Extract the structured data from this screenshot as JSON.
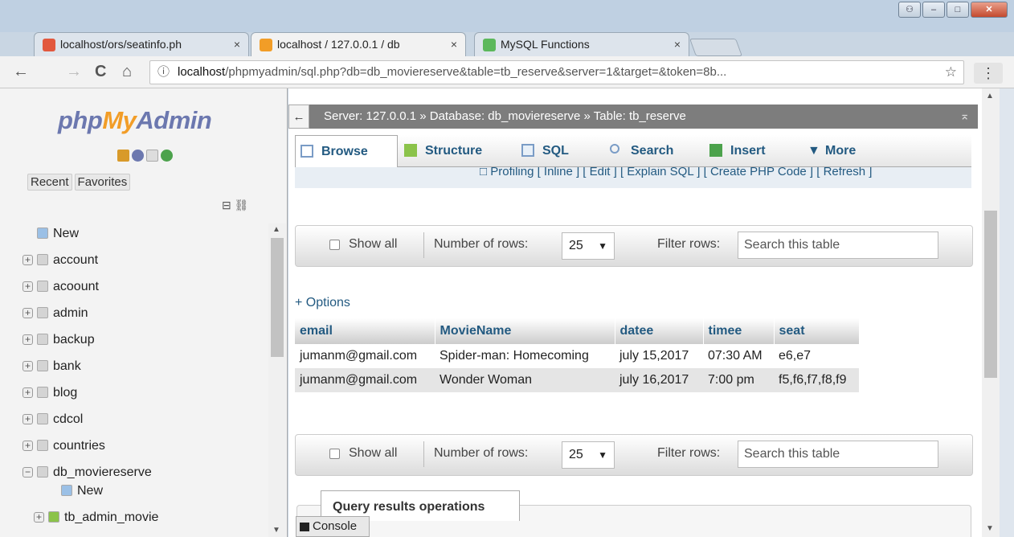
{
  "browser": {
    "tabs": [
      {
        "label": "localhost/ors/seatinfo.ph",
        "close": "×",
        "icon_color": "#e2583e"
      },
      {
        "label": "localhost / 127.0.0.1 / db",
        "close": "×",
        "icon_color": "#f29d27"
      },
      {
        "label": "MySQL Functions",
        "close": "×",
        "icon_color": "#5cb85c"
      }
    ],
    "url_host": "localhost",
    "url_rest": "/phpmyadmin/sql.php?db=db_moviereserve&table=tb_reserve&server=1&target=&token=8b...",
    "back": "←",
    "forward": "→",
    "reload": "C",
    "home": "⌂",
    "info": "ⓘ",
    "star": "☆",
    "menu": "⋮"
  },
  "sidebar": {
    "logo_php": "php",
    "logo_my": "My",
    "logo_admin": "Admin",
    "recent": "Recent",
    "favorites": "Favorites",
    "tree": [
      {
        "label": "New",
        "type": "new"
      },
      {
        "label": "account",
        "type": "db"
      },
      {
        "label": "acoount",
        "type": "db"
      },
      {
        "label": "admin",
        "type": "db"
      },
      {
        "label": "backup",
        "type": "db"
      },
      {
        "label": "bank",
        "type": "db"
      },
      {
        "label": "blog",
        "type": "db"
      },
      {
        "label": "cdcol",
        "type": "db"
      },
      {
        "label": "countries",
        "type": "db"
      },
      {
        "label": "db_moviereserve",
        "type": "db-open"
      },
      {
        "label": "New",
        "type": "sub-new"
      },
      {
        "label": "tb_admin_movie",
        "type": "table"
      }
    ]
  },
  "main": {
    "breadcrumb": "Server: 127.0.0.1 » Database: db_moviereserve » Table: tb_reserve",
    "back_arrow": "←",
    "tabs": [
      "Browse",
      "Structure",
      "SQL",
      "Search",
      "Insert",
      "More"
    ],
    "profiling": "□ Profiling [ Inline ] [ Edit ] [ Explain SQL ] [ Create PHP Code ] [ Refresh ]",
    "nav": {
      "show_all": "Show all",
      "rows_label": "Number of rows:",
      "rows_value": "25",
      "filter_label": "Filter rows:",
      "filter_placeholder": "Search this table"
    },
    "options_link": "+ Options",
    "table": {
      "headers": [
        "email",
        "MovieName",
        "datee",
        "timee",
        "seat"
      ],
      "rows": [
        [
          "jumanm@gmail.com",
          "Spider-man: Homecoming",
          "july 15,2017",
          "07:30 AM",
          "e6,e7"
        ],
        [
          "jumanm@gmail.com",
          "Wonder Woman",
          "july 16,2017",
          "7:00 pm",
          "f5,f6,f7,f8,f9"
        ]
      ]
    },
    "query_ops": "Query results operations",
    "console": "Console"
  }
}
